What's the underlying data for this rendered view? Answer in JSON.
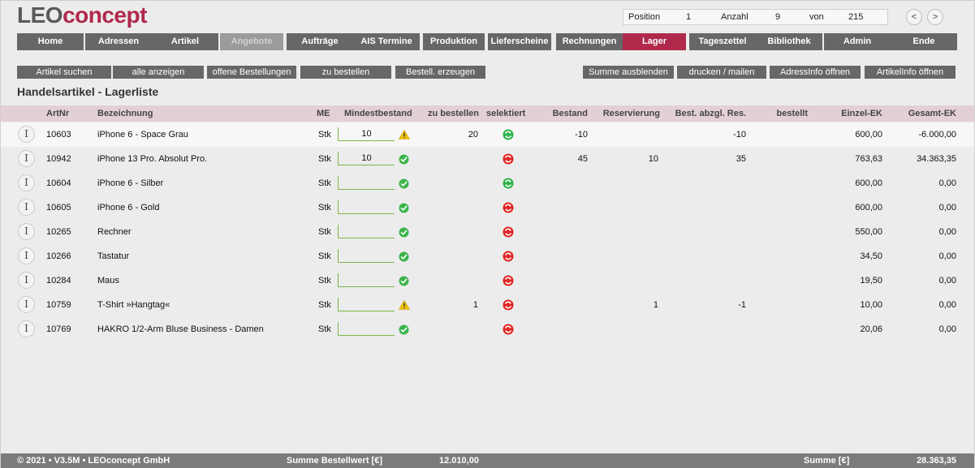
{
  "logo": {
    "part1": "LEO",
    "part2": "concept"
  },
  "position_bar": {
    "position_label": "Position",
    "position_value": "1",
    "count_label": "Anzahl",
    "count_value": "9",
    "of_label": "von",
    "of_value": "215",
    "prev": "<",
    "next": ">"
  },
  "tabs": [
    {
      "label": "Home",
      "state": "normal"
    },
    {
      "label": "Adressen",
      "state": "normal"
    },
    {
      "label": "Artikel",
      "state": "normal"
    },
    {
      "label": "Angebote",
      "state": "disabled"
    },
    {
      "label": "Aufträge",
      "state": "normal"
    },
    {
      "label": "AIS Termine",
      "state": "normal"
    },
    {
      "label": "Produktion",
      "state": "normal"
    },
    {
      "label": "Lieferscheine",
      "state": "normal"
    },
    {
      "label": "Rechnungen",
      "state": "normal"
    },
    {
      "label": "Lager",
      "state": "active"
    },
    {
      "label": "Tageszettel",
      "state": "normal"
    },
    {
      "label": "Bibliothek",
      "state": "normal"
    },
    {
      "label": "Admin",
      "state": "normal"
    },
    {
      "label": "Ende",
      "state": "normal"
    }
  ],
  "actions_left": [
    "Artikel suchen",
    "alle anzeigen",
    "offene Bestellungen",
    "zu bestellen",
    "Bestell. erzeugen"
  ],
  "actions_right": [
    "Summe ausblenden",
    "drucken / mailen",
    "AdressInfo öffnen",
    "ArtikelInfo öffnen"
  ],
  "page_title": "Handelsartikel - Lagerliste",
  "columns": {
    "artnr": "ArtNr",
    "bez": "Bezeichnung",
    "me": "ME",
    "min": "Mindestbestand",
    "zubest": "zu bestellen",
    "sel": "selektiert",
    "bestand": "Bestand",
    "res": "Reservierung",
    "abzgl": "Best. abzgl. Res.",
    "bestellt": "bestellt",
    "einzel": "Einzel-EK",
    "gesamt": "Gesamt-EK"
  },
  "info_glyph": "I",
  "rows": [
    {
      "artnr": "10603",
      "bez": "iPhone 6 - Space Grau",
      "me": "Stk",
      "min": "10",
      "status": "warning",
      "zubest": "20",
      "selected": true,
      "bestand": "-10",
      "res": "",
      "abzgl": "-10",
      "bestellt": "",
      "einzel": "600,00",
      "gesamt": "-6.000,00"
    },
    {
      "artnr": "10942",
      "bez": "iPhone 13 Pro. Absolut Pro.",
      "me": "Stk",
      "min": "10",
      "status": "ok",
      "zubest": "",
      "selected": false,
      "bestand": "45",
      "res": "10",
      "abzgl": "35",
      "bestellt": "",
      "einzel": "763,63",
      "gesamt": "34.363,35"
    },
    {
      "artnr": "10604",
      "bez": "iPhone 6 - Silber",
      "me": "Stk",
      "min": "",
      "status": "ok",
      "zubest": "",
      "selected": true,
      "bestand": "",
      "res": "",
      "abzgl": "",
      "bestellt": "",
      "einzel": "600,00",
      "gesamt": "0,00"
    },
    {
      "artnr": "10605",
      "bez": "iPhone 6 - Gold",
      "me": "Stk",
      "min": "",
      "status": "ok",
      "zubest": "",
      "selected": false,
      "bestand": "",
      "res": "",
      "abzgl": "",
      "bestellt": "",
      "einzel": "600,00",
      "gesamt": "0,00"
    },
    {
      "artnr": "10265",
      "bez": "Rechner",
      "me": "Stk",
      "min": "",
      "status": "ok",
      "zubest": "",
      "selected": false,
      "bestand": "",
      "res": "",
      "abzgl": "",
      "bestellt": "",
      "einzel": "550,00",
      "gesamt": "0,00"
    },
    {
      "artnr": "10266",
      "bez": "Tastatur",
      "me": "Stk",
      "min": "",
      "status": "ok",
      "zubest": "",
      "selected": false,
      "bestand": "",
      "res": "",
      "abzgl": "",
      "bestellt": "",
      "einzel": "34,50",
      "gesamt": "0,00"
    },
    {
      "artnr": "10284",
      "bez": "Maus",
      "me": "Stk",
      "min": "",
      "status": "ok",
      "zubest": "",
      "selected": false,
      "bestand": "",
      "res": "",
      "abzgl": "",
      "bestellt": "",
      "einzel": "19,50",
      "gesamt": "0,00"
    },
    {
      "artnr": "10759",
      "bez": "T-Shirt »Hangtag«",
      "me": "Stk",
      "min": "",
      "status": "warning",
      "zubest": "1",
      "selected": false,
      "bestand": "",
      "res": "1",
      "abzgl": "-1",
      "bestellt": "",
      "einzel": "10,00",
      "gesamt": "0,00"
    },
    {
      "artnr": "10769",
      "bez": "HAKRO 1/2-Arm Bluse Business - Damen",
      "me": "Stk",
      "min": "",
      "status": "ok",
      "zubest": "",
      "selected": false,
      "bestand": "",
      "res": "",
      "abzgl": "",
      "bestellt": "",
      "einzel": "20,06",
      "gesamt": "0,00"
    }
  ],
  "footer": {
    "copyright": "© 2021 • V3.5M • LEOconcept GmbH",
    "order_sum_label": "Summe Bestellwert [€]",
    "order_sum_value": "12.010,00",
    "sum_label": "Summe [€]",
    "sum_value": "28.363,35"
  },
  "colors": {
    "brand": "#b0294b",
    "tab": "#676767",
    "tab_disabled": "#9b9b9b",
    "header_row": "#e3d0d6",
    "ok": "#3cb44b",
    "warning": "#f2c500",
    "selected_on": "#2db34a",
    "selected_off": "#e02424"
  }
}
